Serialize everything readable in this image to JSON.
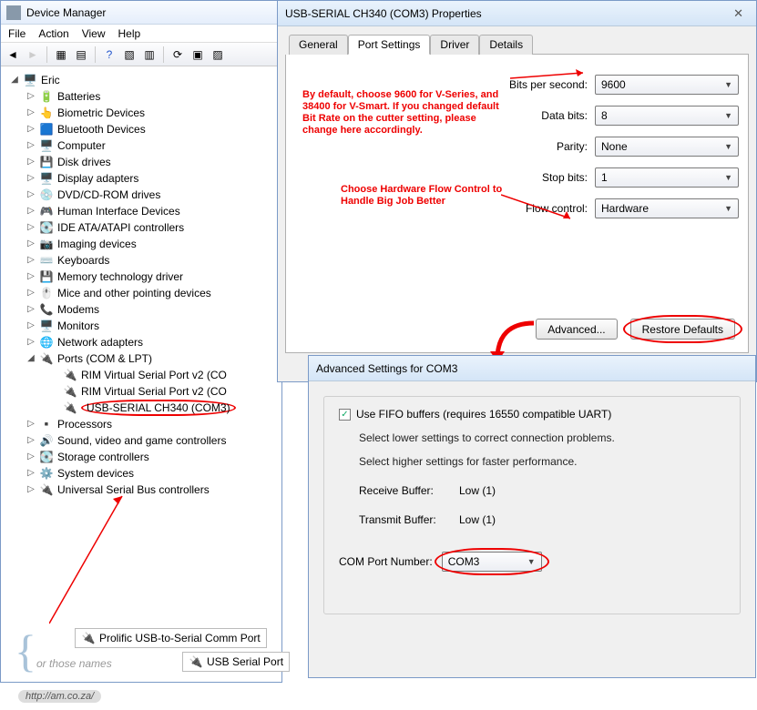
{
  "dm": {
    "title": "Device Manager",
    "menu": [
      "File",
      "Action",
      "View",
      "Help"
    ],
    "root": "Eric",
    "nodes": [
      {
        "label": "Batteries"
      },
      {
        "label": "Biometric Devices"
      },
      {
        "label": "Bluetooth Devices"
      },
      {
        "label": "Computer"
      },
      {
        "label": "Disk drives"
      },
      {
        "label": "Display adapters"
      },
      {
        "label": "DVD/CD-ROM drives"
      },
      {
        "label": "Human Interface Devices"
      },
      {
        "label": "IDE ATA/ATAPI controllers"
      },
      {
        "label": "Imaging devices"
      },
      {
        "label": "Keyboards"
      },
      {
        "label": "Memory technology driver"
      },
      {
        "label": "Mice and other pointing devices"
      },
      {
        "label": "Modems"
      },
      {
        "label": "Monitors"
      },
      {
        "label": "Network adapters"
      },
      {
        "label": "Ports (COM & LPT)",
        "expanded": true
      },
      {
        "label": "Processors"
      },
      {
        "label": "Sound, video and game controllers"
      },
      {
        "label": "Storage controllers"
      },
      {
        "label": "System devices"
      },
      {
        "label": "Universal Serial Bus controllers"
      }
    ],
    "ports_children": [
      "RIM Virtual Serial Port v2 (CO",
      "RIM Virtual Serial Port v2 (CO",
      "USB-SERIAL CH340 (COM3)"
    ]
  },
  "props": {
    "title": "USB-SERIAL CH340 (COM3) Properties",
    "tabs": [
      "General",
      "Port Settings",
      "Driver",
      "Details"
    ],
    "fields": {
      "bps_label": "Bits per second:",
      "bps_value": "9600",
      "data_label": "Data bits:",
      "data_value": "8",
      "parity_label": "Parity:",
      "parity_value": "None",
      "stop_label": "Stop bits:",
      "stop_value": "1",
      "flow_label": "Flow control:",
      "flow_value": "Hardware"
    },
    "advanced_btn": "Advanced...",
    "restore_btn": "Restore Defaults",
    "annot1": "By default, choose 9600 for V-Series, and 38400 for V-Smart.\nIf you changed default Bit Rate on the cutter setting, please change here accordingly.",
    "annot2": "Choose Hardware Flow Control to Handle Big Job Better"
  },
  "adv": {
    "title": "Advanced Settings for COM3",
    "fifo": "Use FIFO buffers (requires 16550 compatible UART)",
    "help1": "Select lower settings to correct connection problems.",
    "help2": "Select higher settings for faster performance.",
    "rx_label": "Receive Buffer:",
    "rx_low": "Low (1)",
    "tx_label": "Transmit Buffer:",
    "tx_low": "Low (1)",
    "com_label": "COM Port Number:",
    "com_value": "COM3"
  },
  "floats": {
    "a": "Prolific USB-to-Serial Comm Port",
    "b": "USB Serial Port",
    "note": "or those names",
    "url": "http://am.co.za/"
  }
}
